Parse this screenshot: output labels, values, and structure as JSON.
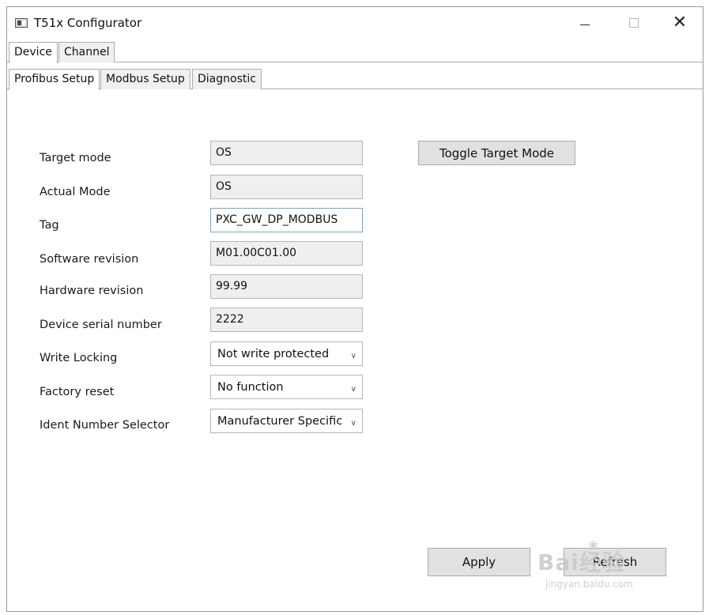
{
  "window": {
    "title": "T51x Configurator"
  },
  "outer_tabs": [
    {
      "label": "Device",
      "active": true
    },
    {
      "label": "Channel",
      "active": false
    }
  ],
  "inner_tabs": [
    {
      "label": "Profibus Setup",
      "active": true
    },
    {
      "label": "Modbus Setup",
      "active": false
    },
    {
      "label": "Diagnostic",
      "active": false
    }
  ],
  "form": {
    "target_mode": {
      "label": "Target mode",
      "value": "OS"
    },
    "actual_mode": {
      "label": "Actual Mode",
      "value": "OS"
    },
    "tag": {
      "label": "Tag",
      "value": "PXC_GW_DP_MODBUS"
    },
    "software_revision": {
      "label": "Software revision",
      "value": "M01.00C01.00"
    },
    "hardware_revision": {
      "label": "Hardware revision",
      "value": "99.99"
    },
    "serial_number": {
      "label": "Device serial number",
      "value": "2222"
    },
    "write_locking": {
      "label": "Write Locking",
      "value": "Not write protected"
    },
    "factory_reset": {
      "label": "Factory reset",
      "value": "No function"
    },
    "ident_number_selector": {
      "label": "Ident Number Selector",
      "value": "Manufacturer Specific"
    }
  },
  "buttons": {
    "toggle_target_mode": "Toggle Target Mode",
    "apply": "Apply",
    "refresh": "Refresh"
  },
  "watermark": {
    "brand": "Bai经验",
    "url": "jingyan.baidu.com"
  },
  "icons": {
    "app": "app-window-icon",
    "minimize": "minimize-icon",
    "maximize": "maximize-icon",
    "close": "close-icon",
    "dropdown": "chevron-down-icon"
  }
}
